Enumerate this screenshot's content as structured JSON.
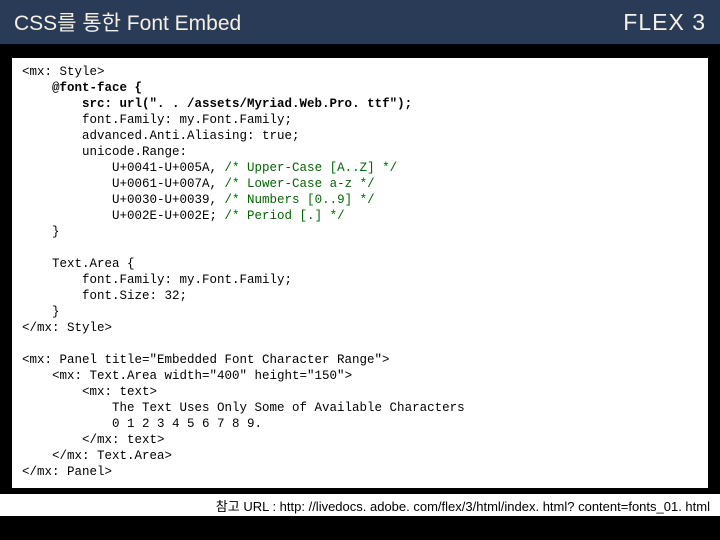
{
  "header": {
    "title": "CSS를 통한 Font Embed",
    "brand": "FLEX 3"
  },
  "code": {
    "l1": "<mx: Style>",
    "l2": "@font-face {",
    "l3a": "src: url(\"",
    "l3b": ". . /assets/Myriad.Web.Pro. ttf\"",
    "l3c": ");",
    "l4": "font.Family: my.Font.Family;",
    "l5": "advanced.Anti.Aliasing: true;",
    "l6": "unicode.Range:",
    "l7a": "U+0041-U+005A,",
    "l7b": " /* Upper-Case [A..Z] */",
    "l8a": "U+0061-U+007A,",
    "l8b": " /* Lower-Case a-z */",
    "l9a": "U+0030-U+0039,",
    "l9b": " /* Numbers [0..9] */",
    "l10a": "U+002E-U+002E;",
    "l10b": " /* Period [.] */",
    "l11": "}",
    "l12": "Text.Area {",
    "l13": "font.Family: my.Font.Family;",
    "l14": "font.Size: 32;",
    "l15": "}",
    "l16": "</mx: Style>",
    "l17": "<mx: Panel title=\"Embedded Font Character Range\">",
    "l18": "<mx: Text.Area width=\"400\" height=\"150\">",
    "l19": "<mx: text>",
    "l20": "The Text Uses Only Some of Available Characters",
    "l21": "0 1 2 3 4 5 6 7 8 9.",
    "l22": "</mx: text>",
    "l23": "</mx: Text.Area>",
    "l24": "</mx: Panel>"
  },
  "ref": {
    "label": "참고 URL : http: //livedocs. adobe. com/flex/3/html/index. html? content=fonts_01. html"
  }
}
